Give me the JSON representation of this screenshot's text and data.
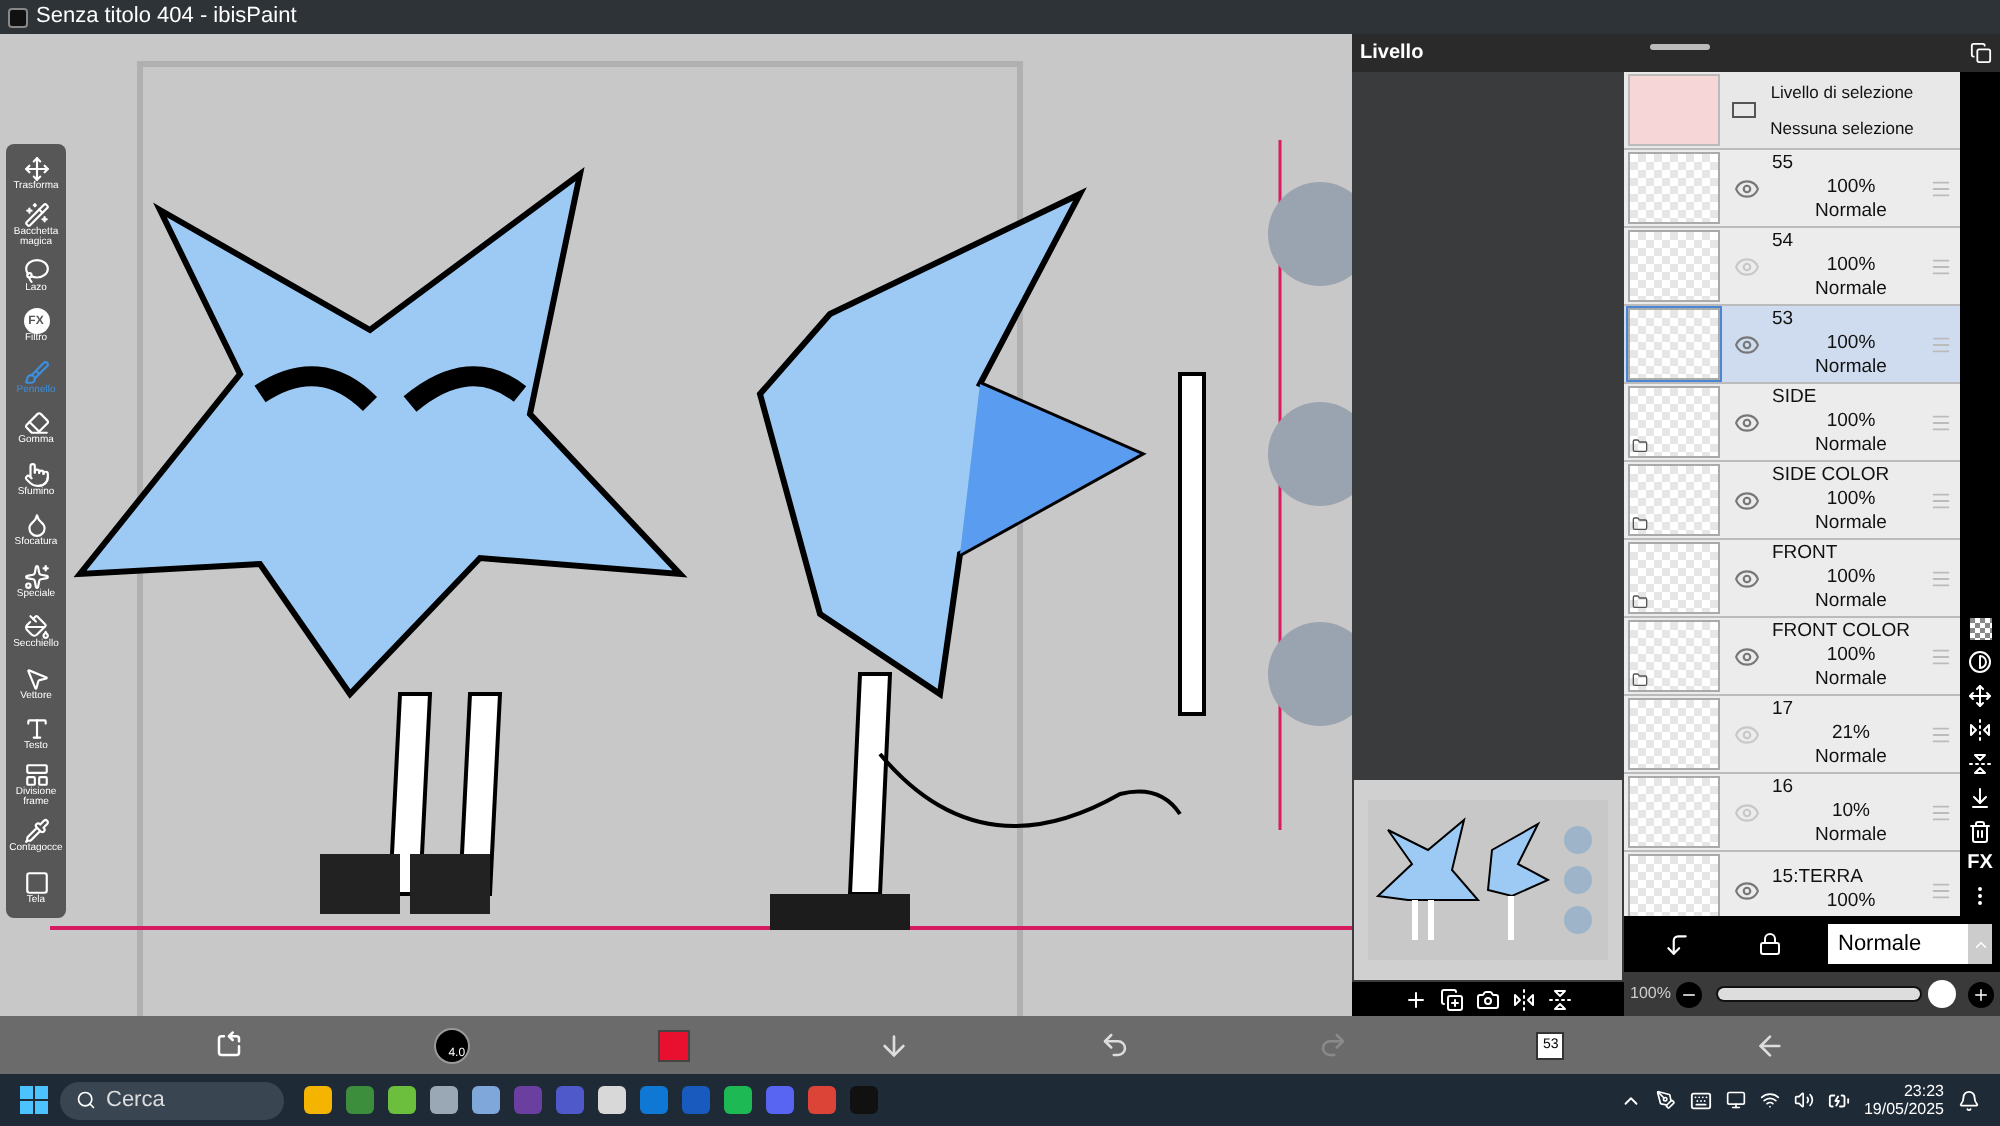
{
  "window": {
    "title": "Senza titolo 404 - ibisPaint"
  },
  "tools": [
    {
      "kind": "move",
      "label": "Trasforma",
      "selected": false
    },
    {
      "kind": "wand",
      "label": "Bacchetta magica",
      "selected": false
    },
    {
      "kind": "lasso",
      "label": "Lazo",
      "selected": false
    },
    {
      "kind": "filter",
      "glyph": "FX",
      "label": "Filtro",
      "selected": false
    },
    {
      "kind": "brush",
      "label": "Pennello",
      "selected": true
    },
    {
      "kind": "eraser",
      "label": "Gomma",
      "selected": false
    },
    {
      "kind": "smudge",
      "label": "Sfumino",
      "selected": false
    },
    {
      "kind": "blur",
      "label": "Sfocatura",
      "selected": false
    },
    {
      "kind": "special",
      "label": "Speciale",
      "selected": false
    },
    {
      "kind": "bucket",
      "label": "Secchiello",
      "selected": false
    },
    {
      "kind": "vector",
      "label": "Vettore",
      "selected": false
    },
    {
      "kind": "text",
      "label": "Testo",
      "selected": false
    },
    {
      "kind": "frame",
      "label": "Divisione frame",
      "selected": false
    },
    {
      "kind": "picker",
      "label": "Contagocce",
      "selected": false
    },
    {
      "kind": "canvas",
      "label": "Tela",
      "selected": false
    }
  ],
  "layer_panel": {
    "title": "Livello",
    "selection_layer": {
      "name": "Livello di selezione",
      "status": "Nessuna selezione"
    },
    "layers": [
      {
        "name": "55",
        "opacity": "100%",
        "blend": "Normale",
        "visible": true,
        "selected": false,
        "folder": false
      },
      {
        "name": "54",
        "opacity": "100%",
        "blend": "Normale",
        "visible": false,
        "selected": false,
        "folder": false
      },
      {
        "name": "53",
        "opacity": "100%",
        "blend": "Normale",
        "visible": true,
        "selected": true,
        "folder": false
      },
      {
        "name": "SIDE",
        "opacity": "100%",
        "blend": "Normale",
        "visible": true,
        "selected": false,
        "folder": true
      },
      {
        "name": "SIDE COLOR",
        "opacity": "100%",
        "blend": "Normale",
        "visible": true,
        "selected": false,
        "folder": true
      },
      {
        "name": "FRONT",
        "opacity": "100%",
        "blend": "Normale",
        "visible": true,
        "selected": false,
        "folder": true
      },
      {
        "name": "FRONT COLOR",
        "opacity": "100%",
        "blend": "Normale",
        "visible": true,
        "selected": false,
        "folder": true
      },
      {
        "name": "17",
        "opacity": "21%",
        "blend": "Normale",
        "visible": false,
        "selected": false,
        "folder": false
      },
      {
        "name": "16",
        "opacity": "10%",
        "blend": "Normale",
        "visible": false,
        "selected": false,
        "folder": false
      },
      {
        "name": "15:TERRA",
        "opacity": "100%",
        "visible": true,
        "selected": false,
        "folder": false
      }
    ],
    "side_fx_label": "FX",
    "blend_mode": "Normale",
    "opacity_reading": "100%",
    "opacity_slider": {
      "level": 1
    }
  },
  "bottom_toolbar": {
    "brush_size": "4.0",
    "redo_disabled": true,
    "layer_count": "53"
  },
  "taskbar": {
    "search_placeholder": "Cerca",
    "apps": [
      {
        "color": "#f4b400"
      },
      {
        "color": "#3c8d3c"
      },
      {
        "color": "#6cbf3c"
      },
      {
        "color": "#9aa7b5"
      },
      {
        "color": "#7fa7d9"
      },
      {
        "color": "#6b3fa0"
      },
      {
        "color": "#5059c9"
      },
      {
        "color": "#d8d8d8"
      },
      {
        "color": "#0f78d4"
      },
      {
        "color": "#185abd"
      },
      {
        "color": "#1db954"
      },
      {
        "color": "#5865f2"
      },
      {
        "color": "#db4437"
      },
      {
        "color": "#111111"
      }
    ],
    "time": "23:23",
    "date": "19/05/2025"
  }
}
